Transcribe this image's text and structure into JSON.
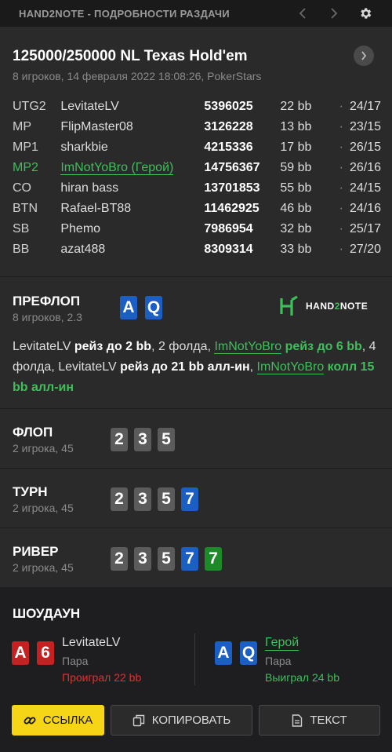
{
  "window": {
    "title": "HAND2NOTE - ПОДРОБНОСТИ РАЗДАЧИ",
    "icons": [
      "chevron-left-icon",
      "chevron-right-icon",
      "gear-icon"
    ]
  },
  "header": {
    "title": "125000/250000 NL Texas Hold'em",
    "subtitle": "8 игроков, 14 февраля 2022 18:08:26, PokerStars"
  },
  "players": [
    {
      "pos": "UTG2",
      "name": "LevitateLV",
      "stack": "5396025",
      "bb": "22 bb",
      "hud": "24/17"
    },
    {
      "pos": "MP",
      "name": "FlipMaster08",
      "stack": "3126228",
      "bb": "13 bb",
      "hud": "23/15"
    },
    {
      "pos": "MP1",
      "name": "sharkbie",
      "stack": "4215336",
      "bb": "17 bb",
      "hud": "26/15"
    },
    {
      "pos": "MP2",
      "name": "ImNotYoBro (Герой)",
      "stack": "14756367",
      "bb": "59 bb",
      "hud": "26/16",
      "hero": true
    },
    {
      "pos": "CO",
      "name": "hiran bass",
      "stack": "13701853",
      "bb": "55 bb",
      "hud": "24/15"
    },
    {
      "pos": "BTN",
      "name": "Rafael-BT88",
      "stack": "11462925",
      "bb": "46 bb",
      "hud": "24/16"
    },
    {
      "pos": "SB",
      "name": "Phemo",
      "stack": "7986954",
      "bb": "32 bb",
      "hud": "25/17"
    },
    {
      "pos": "BB",
      "name": "azat488",
      "stack": "8309314",
      "bb": "33 bb",
      "hud": "27/20"
    }
  ],
  "hud_separator": "·",
  "preflop": {
    "title": "ПРЕФЛОП",
    "subtitle": "8 игроков, 2.3",
    "hero_cards": [
      {
        "rank": "A",
        "suit": "diamond"
      },
      {
        "rank": "Q",
        "suit": "diamond"
      }
    ],
    "logo": {
      "text_a": "HAND",
      "text_b": "2",
      "text_c": "NOTE"
    },
    "actions": {
      "p1": "LevitateLV",
      "a1": "рейз до 2 bb",
      "t1": ", 2 фолда,",
      "hero1": "ImNotYoBro",
      "a2": "рейз до 6 bb",
      "t2": ", 4 фолда,",
      "p2": "LevitateLV",
      "a3": "рейз до 21 bb алл-ин",
      "t3": ",",
      "hero2": "ImNotYoBro",
      "a4": "колл 15 bb алл-ин"
    }
  },
  "flop": {
    "title": "ФЛОП",
    "subtitle": "2 игрока, 45",
    "cards": [
      {
        "rank": "2",
        "suit": "spade"
      },
      {
        "rank": "3",
        "suit": "spade"
      },
      {
        "rank": "5",
        "suit": "spade"
      }
    ]
  },
  "turn": {
    "title": "ТУРН",
    "subtitle": "2 игрока, 45",
    "cards": [
      {
        "rank": "2",
        "suit": "spade"
      },
      {
        "rank": "3",
        "suit": "spade"
      },
      {
        "rank": "5",
        "suit": "spade"
      },
      {
        "rank": "7",
        "suit": "diamond"
      }
    ]
  },
  "river": {
    "title": "РИВЕР",
    "subtitle": "2 игрока, 45",
    "cards": [
      {
        "rank": "2",
        "suit": "spade"
      },
      {
        "rank": "3",
        "suit": "spade"
      },
      {
        "rank": "5",
        "suit": "spade"
      },
      {
        "rank": "7",
        "suit": "diamond"
      },
      {
        "rank": "7",
        "suit": "club"
      }
    ]
  },
  "showdown": {
    "title": "ШОУДАУН",
    "left": {
      "cards": [
        {
          "rank": "A",
          "suit": "heart"
        },
        {
          "rank": "6",
          "suit": "heart"
        }
      ],
      "name": "LevitateLV",
      "hand": "Пара",
      "result": "Проиграл 22 bb"
    },
    "right": {
      "cards": [
        {
          "rank": "A",
          "suit": "diamond"
        },
        {
          "rank": "Q",
          "suit": "diamond"
        }
      ],
      "name": "Герой",
      "hand": "Пара",
      "result": "Выиграл 24 bb"
    }
  },
  "buttons": {
    "link": "ССЫЛКА",
    "copy": "КОПИРОВАТЬ",
    "text": "ТЕКСТ"
  },
  "colors": {
    "hero": "#3fbf5a",
    "loss": "#e23030",
    "win": "#3fbf5a",
    "link_button": "#f5d516",
    "spade_card": "#5b5b5c",
    "diamond_card": "#1b5fc4",
    "club_card": "#1d8a2a",
    "heart_card": "#c42222"
  }
}
